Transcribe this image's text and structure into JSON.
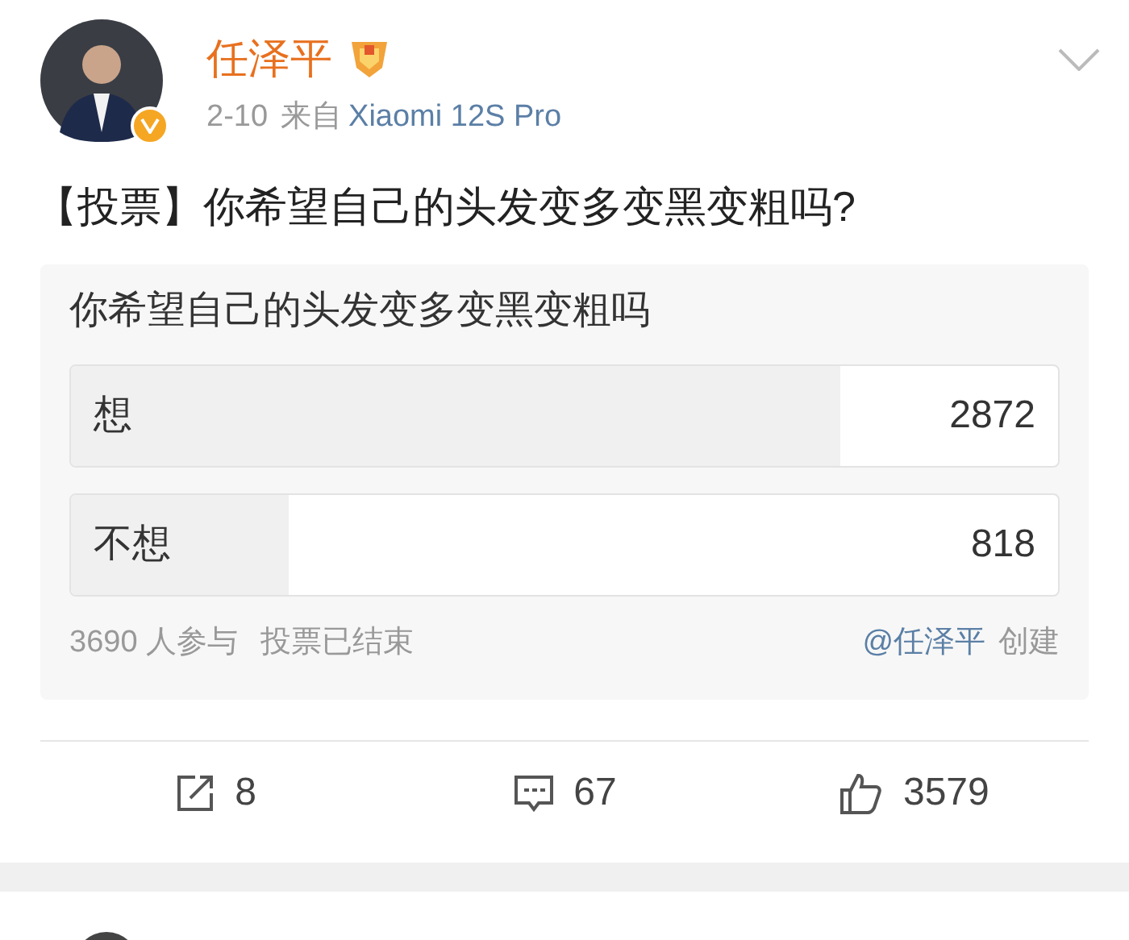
{
  "post": {
    "author": "任泽平",
    "date": "2-10",
    "source_prefix": "来自",
    "source": "Xiaomi 12S Pro",
    "text": "【投票】你希望自己的头发变多变黑变粗吗?"
  },
  "poll": {
    "title": "你希望自己的头发变多变黑变粗吗",
    "options": [
      {
        "label": "想",
        "count": "2872",
        "level": 0.78
      },
      {
        "label": "不想",
        "count": "818",
        "level": 0.22
      }
    ],
    "participants": "3690 人参与",
    "status": "投票已结束",
    "creator": "@任泽平",
    "created_label": "创建"
  },
  "actions": [
    {
      "kind": "repost",
      "count": "8"
    },
    {
      "kind": "comment",
      "count": "67"
    },
    {
      "kind": "like",
      "count": "3579"
    }
  ]
}
